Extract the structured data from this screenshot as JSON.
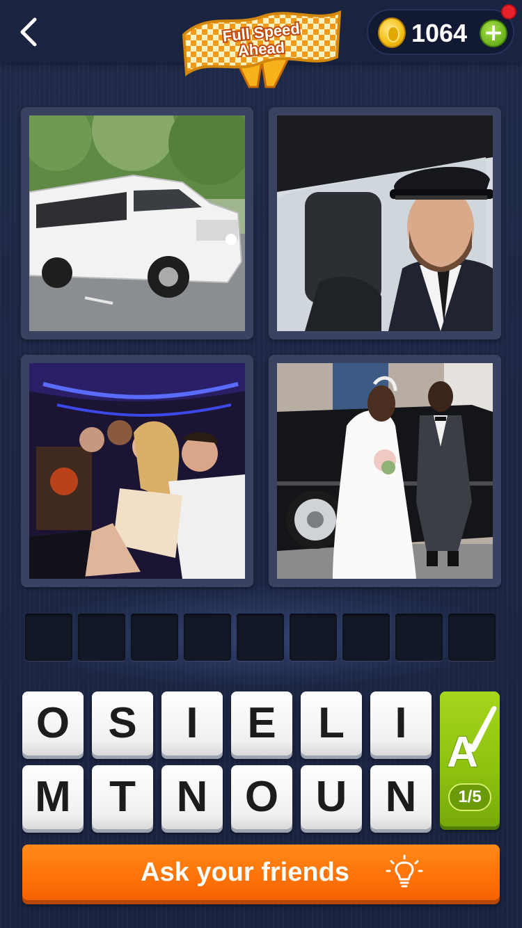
{
  "header": {
    "back_icon": "chevron-left-icon",
    "banner_line1": "Full Speed",
    "banner_line2": "Ahead",
    "coins": "1064",
    "add_coins_label": "+",
    "colors": {
      "bar": "#1a2340",
      "coin": "#f5c21a",
      "add": "#6cb21c",
      "notification": "#e8202a"
    }
  },
  "photos": [
    {
      "subject": "white stretch limousine"
    },
    {
      "subject": "chauffeur in cap driving"
    },
    {
      "subject": "party inside limo"
    },
    {
      "subject": "wedding couple by black car"
    }
  ],
  "answer": {
    "slots": 9
  },
  "letters": {
    "row1": [
      "O",
      "S",
      "I",
      "E",
      "L",
      "I"
    ],
    "row2": [
      "M",
      "T",
      "N",
      "O",
      "U",
      "N"
    ]
  },
  "hint": {
    "icon": "paintbrush-letter-icon",
    "glyph": "A",
    "count": "1/5",
    "color": "#8cc10f"
  },
  "ask": {
    "label": "Ask your friends",
    "icon": "lightbulb-icon",
    "color": "#ff7409"
  }
}
